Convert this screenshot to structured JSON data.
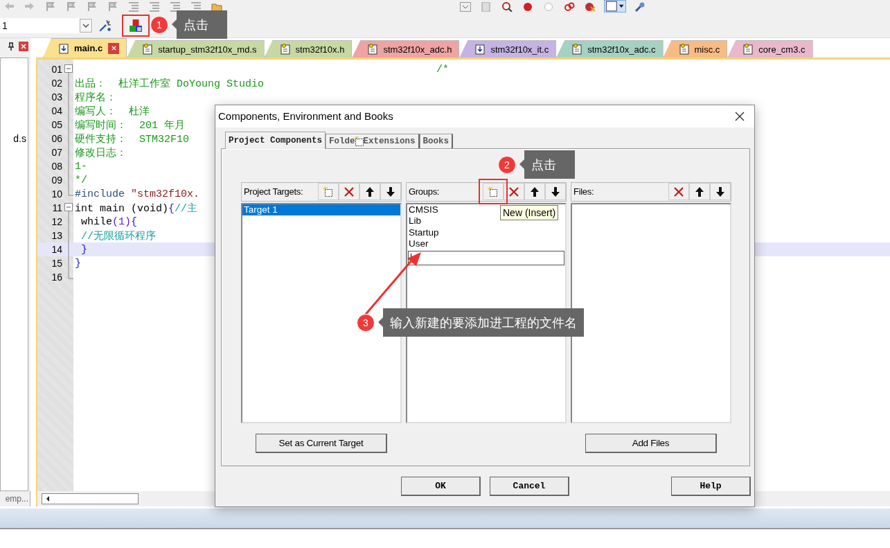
{
  "target_combo": {
    "value": "1"
  },
  "toolbar": {
    "components_highlighted": true
  },
  "left_panel": {
    "file_text": "d.s",
    "tab_label": "emp..."
  },
  "tabs": [
    {
      "label": "main.c",
      "color": "#fbe08d",
      "kind": "source",
      "selected": true
    },
    {
      "label": "startup_stm32f10x_md.s",
      "color": "#c6d9a2",
      "kind": "header",
      "selected": false
    },
    {
      "label": "stm32f10x.h",
      "color": "#c6d9a2",
      "kind": "header",
      "selected": false
    },
    {
      "label": "stm32f10x_adc.h",
      "color": "#f0a3a3",
      "kind": "header",
      "selected": false
    },
    {
      "label": "stm32f10x_it.c",
      "color": "#c5b3e3",
      "kind": "source",
      "selected": false
    },
    {
      "label": "stm32f10x_adc.c",
      "color": "#a6d1c2",
      "kind": "header",
      "selected": false
    },
    {
      "label": "misc.c",
      "color": "#f8bb84",
      "kind": "header",
      "selected": false
    },
    {
      "label": "core_cm3.c",
      "color": "#e9b8cb",
      "kind": "header",
      "selected": false
    }
  ],
  "code_lines": [
    {
      "n": "01",
      "kind": "open",
      "current": false,
      "parts": [
        {
          "text": "                                                          /*",
          "kind": "comment"
        }
      ]
    },
    {
      "n": "02",
      "kind": "body",
      "current": false,
      "parts": [
        {
          "text": "出品：  杜洋工作室 DoYoung Studio",
          "kind": "comment"
        }
      ]
    },
    {
      "n": "03",
      "kind": "body",
      "current": false,
      "parts": [
        {
          "text": "程序名：",
          "kind": "comment"
        }
      ]
    },
    {
      "n": "04",
      "kind": "body",
      "current": false,
      "parts": [
        {
          "text": "编写人：  杜洋",
          "kind": "comment"
        }
      ]
    },
    {
      "n": "05",
      "kind": "body",
      "current": false,
      "parts": [
        {
          "text": "编写时间：  201 年月",
          "kind": "comment"
        }
      ]
    },
    {
      "n": "06",
      "kind": "body",
      "current": false,
      "parts": [
        {
          "text": "硬件支持：  STM32F10",
          "kind": "comment"
        }
      ]
    },
    {
      "n": "07",
      "kind": "body",
      "current": false,
      "parts": [
        {
          "text": "修改日志：",
          "kind": "comment"
        }
      ]
    },
    {
      "n": "08",
      "kind": "body",
      "current": false,
      "parts": [
        {
          "text": "1-",
          "kind": "comment"
        }
      ]
    },
    {
      "n": "09",
      "kind": "body",
      "current": false,
      "parts": [
        {
          "text": "*/",
          "kind": "comment"
        }
      ]
    },
    {
      "n": "10",
      "kind": "end",
      "current": false,
      "parts": [
        {
          "text": "#include ",
          "kind": "preproc"
        },
        {
          "text": "\"stm32f10x.",
          "kind": "string"
        }
      ]
    },
    {
      "n": "11",
      "kind": "open",
      "current": false,
      "parts": [
        {
          "text": "int main (void)",
          "kind": "keyword"
        },
        {
          "text": "{",
          "kind": "brace"
        },
        {
          "text": "//主",
          "kind": "comment2"
        }
      ]
    },
    {
      "n": "12",
      "kind": "body",
      "current": false,
      "parts": [
        {
          "text": " while",
          "kind": "keyword"
        },
        {
          "text": "(1)",
          "kind": "number"
        },
        {
          "text": "{",
          "kind": "brace"
        }
      ]
    },
    {
      "n": "13",
      "kind": "body",
      "current": false,
      "parts": [
        {
          "text": " //无限循环程序",
          "kind": "comment2"
        }
      ]
    },
    {
      "n": "14",
      "kind": "body",
      "current": true,
      "parts": [
        {
          "text": " }",
          "kind": "brace"
        }
      ]
    },
    {
      "n": "15",
      "kind": "body",
      "current": false,
      "parts": [
        {
          "text": "}",
          "kind": "brace"
        }
      ]
    },
    {
      "n": "16",
      "kind": "end",
      "current": false
    }
  ],
  "dialog": {
    "title": "Components, Environment and Books",
    "tabs": [
      {
        "label": "Project Components",
        "selected": true
      },
      {
        "label": "Folde",
        "label_after": "Extensions",
        "selected": false
      },
      {
        "label": "Books",
        "selected": false
      }
    ],
    "panels": [
      {
        "title": "Project Targets:",
        "tools": [
          {
            "kind": "new",
            "highlighted": false
          },
          {
            "kind": "delete",
            "highlighted": false
          },
          {
            "kind": "up",
            "highlighted": false
          },
          {
            "kind": "down",
            "highlighted": false
          }
        ],
        "items": [
          {
            "label": "Target 1",
            "selected": true
          }
        ],
        "button": "Set as Current Target"
      },
      {
        "title": "Groups:",
        "tools": [
          {
            "kind": "new",
            "highlighted": true
          },
          {
            "kind": "delete",
            "highlighted": false
          },
          {
            "kind": "up",
            "highlighted": false
          },
          {
            "kind": "down",
            "highlighted": false
          }
        ],
        "items": [
          {
            "label": "CMSIS",
            "selected": false
          },
          {
            "label": "Lib",
            "selected": false
          },
          {
            "label": "Startup",
            "selected": false
          },
          {
            "label": "User",
            "selected": false
          }
        ],
        "editing": true,
        "tooltip": "New (Insert)"
      },
      {
        "title": "Files:",
        "tools": [
          {
            "kind": "delete",
            "highlighted": false
          },
          {
            "kind": "up",
            "highlighted": false
          },
          {
            "kind": "down",
            "highlighted": false
          }
        ],
        "button": "Add Files"
      }
    ],
    "buttons": [
      "OK",
      "Cancel",
      "Help"
    ]
  },
  "annotations": [
    {
      "number": "1",
      "text": "点击"
    },
    {
      "number": "2",
      "text": "点击"
    },
    {
      "number": "3",
      "text": "输入新建的要添加进工程的文件名"
    }
  ]
}
